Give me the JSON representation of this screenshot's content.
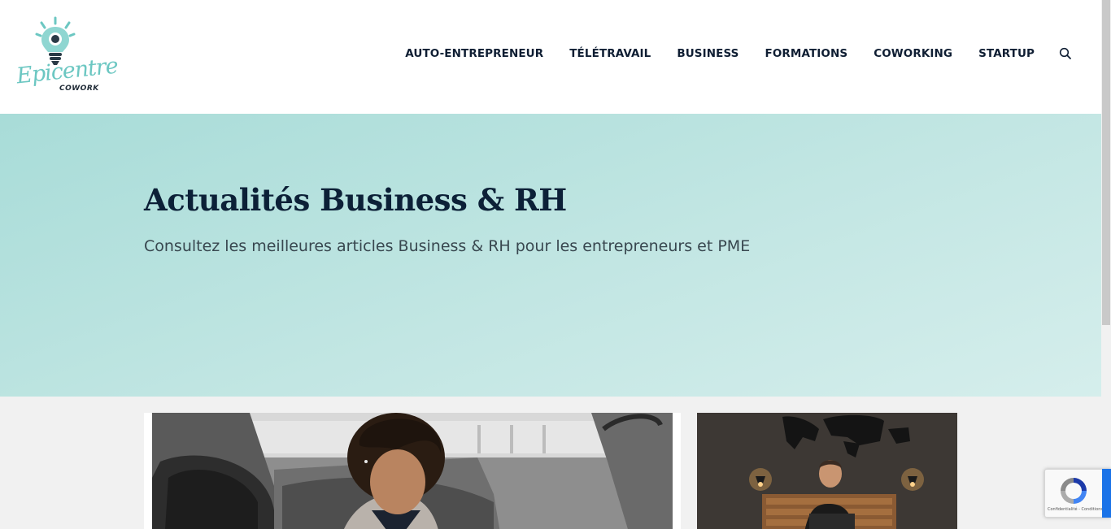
{
  "logo": {
    "word": "Epicentre",
    "sub": "COWORK",
    "colors": {
      "teal": "#6cc7c2",
      "dark": "#1f2a36"
    }
  },
  "nav": {
    "items": [
      {
        "label": "AUTO-ENTREPRENEUR"
      },
      {
        "label": "TÉLÉTRAVAIL"
      },
      {
        "label": "BUSINESS"
      },
      {
        "label": "FORMATIONS"
      },
      {
        "label": "COWORKING"
      },
      {
        "label": "STARTUP"
      }
    ],
    "search_icon": "search-icon"
  },
  "hero": {
    "title": "Actualités Business & RH",
    "subtitle": "Consultez les meilleures articles Business & RH pour les entrepreneurs et PME",
    "colors": {
      "bg_start": "#a8dcd8",
      "bg_end": "#d5eeec",
      "title": "#0c2037"
    }
  },
  "articles": [
    {
      "image": "woman-working-in-car-photo"
    },
    {
      "image": "man-with-laptop-on-bed-photo"
    }
  ],
  "recaptcha": {
    "legal": "Confidentialité - Conditions",
    "icon": "recaptcha-icon"
  }
}
